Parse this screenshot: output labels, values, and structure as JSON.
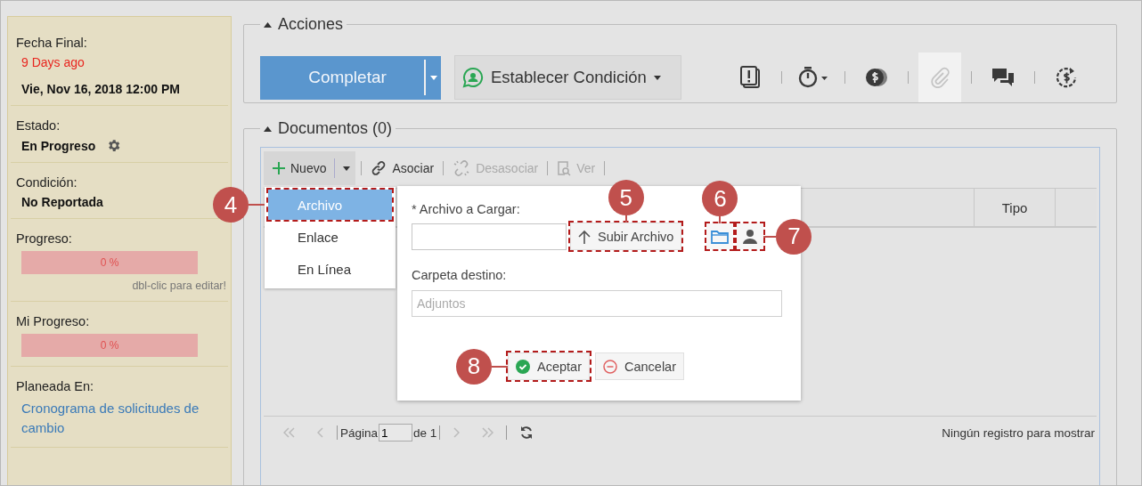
{
  "sidebar": {
    "sections": [
      {
        "kind": "date",
        "label": "Fecha Final:",
        "relative": "9 Days ago",
        "value": "Vie, Nov 16, 2018 12:00 PM"
      },
      {
        "kind": "status",
        "label": "Estado:",
        "value": "En Progreso"
      },
      {
        "kind": "text",
        "label": "Condición:",
        "value": "No Reportada"
      },
      {
        "kind": "progress",
        "label": "Progreso:",
        "level": 0,
        "reading": "0 %",
        "hint": "dbl-clic para editar!"
      },
      {
        "kind": "progress",
        "label": "Mi Progreso:",
        "level": 0,
        "reading": "0 %"
      },
      {
        "kind": "link",
        "label": "Planeada En:",
        "value": "Cronograma de solicitudes de cambio"
      }
    ]
  },
  "actions": {
    "title": "Acciones",
    "expanded": true,
    "primary_button": "Completar",
    "condition_button": "Establecer Condición",
    "tools": [
      {
        "kind": "notes",
        "disabled": false
      },
      {
        "kind": "timer",
        "disabled": false
      },
      {
        "kind": "coin",
        "disabled": false
      },
      {
        "kind": "attach",
        "disabled": true
      },
      {
        "kind": "chat",
        "disabled": false
      },
      {
        "kind": "refund",
        "disabled": false
      }
    ]
  },
  "documents": {
    "title": "Documentos (0)",
    "expanded": true,
    "toolbar": [
      {
        "kind": "new",
        "label": "Nuevo",
        "disabled": false
      },
      {
        "kind": "link",
        "label": "Asociar",
        "disabled": false
      },
      {
        "kind": "unlink",
        "label": "Desasociar",
        "disabled": true
      },
      {
        "kind": "view",
        "label": "Ver",
        "disabled": true
      }
    ],
    "new_menu": [
      {
        "label": "Archivo",
        "selected": true,
        "callout": "4"
      },
      {
        "label": "Enlace",
        "selected": false
      },
      {
        "label": "En Línea",
        "selected": false
      }
    ],
    "columns": [
      "Tipo"
    ],
    "pager": {
      "page_label": "Página",
      "page": "1",
      "of_label": "de 1",
      "status": "Ningún registro para mostrar"
    }
  },
  "upload_dialog": {
    "file_label": "* Archivo a Cargar:",
    "upload_button": {
      "label": "Subir Archivo",
      "callout": "5"
    },
    "folder_button": {
      "callout": "6"
    },
    "user_button": {
      "callout": "7"
    },
    "folder_label": "Carpeta destino:",
    "folder_placeholder": "Adjuntos",
    "ok_button": {
      "label": "Aceptar",
      "callout": "8"
    },
    "cancel_button": {
      "label": "Cancelar"
    }
  }
}
